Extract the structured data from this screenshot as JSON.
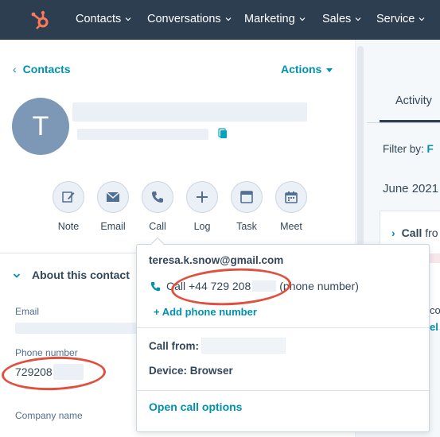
{
  "nav": {
    "items": [
      {
        "label": "Contacts"
      },
      {
        "label": "Conversations"
      },
      {
        "label": "Marketing"
      },
      {
        "label": "Sales"
      },
      {
        "label": "Service"
      }
    ]
  },
  "header": {
    "back_label": "Contacts",
    "actions_label": "Actions"
  },
  "contact": {
    "avatar_initial": "T"
  },
  "quick_actions": [
    {
      "label": "Note"
    },
    {
      "label": "Email"
    },
    {
      "label": "Call"
    },
    {
      "label": "Log"
    },
    {
      "label": "Task"
    },
    {
      "label": "Meet"
    }
  ],
  "about": {
    "title": "About this contact",
    "email_label": "Email",
    "phone_label": "Phone number",
    "phone_value": "729208",
    "company_label": "Company name"
  },
  "activity": {
    "tab_label": "Activity",
    "filter_label": "Filter by:",
    "filter_value": "F",
    "month": "June 2021",
    "card_title": "Call",
    "card_from": "fro",
    "card_mini1": "co",
    "card_mini2": "el"
  },
  "call_popover": {
    "email": "teresa.k.snow@gmail.com",
    "call_prefix": "Call +44 729 208",
    "call_suffix": "(phone number)",
    "add_phone": "+ Add phone number",
    "call_from_label": "Call from:",
    "device_label": "Device: Browser",
    "open_options": "Open call options"
  },
  "colors": {
    "nav_bg": "#2d3e50",
    "accent": "#0091ae",
    "logo": "#ff7a59",
    "annotation": "#e0503f"
  }
}
